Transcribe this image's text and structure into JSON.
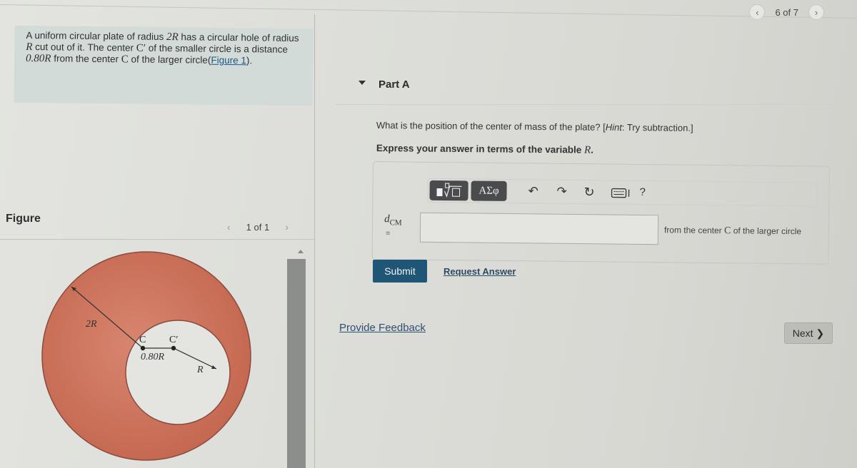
{
  "pager": {
    "current_label": "6 of 7",
    "prev_icon": "chevron-left-icon",
    "next_icon": "chevron-right-icon"
  },
  "problem": {
    "text_1": "A uniform circular plate of radius ",
    "var_2R": "2R",
    "text_2": " has a circular hole of radius ",
    "var_R": "R",
    "text_3": " cut out of it. The center ",
    "var_Cprime": "C′",
    "text_4": " of the smaller circle is a distance ",
    "var_dist": "0.80R",
    "text_5": " from the center ",
    "var_C": "C",
    "text_6": " of the larger circle(",
    "figure_link": "Figure 1",
    "text_7": ")."
  },
  "figure": {
    "title": "Figure",
    "pager_label": "1 of 1",
    "labels": {
      "outer_radius": "2R",
      "inner_radius": "R",
      "center": "C",
      "center_prime": "C′",
      "distance": "0.80R"
    },
    "colors": {
      "plate": "#c9705a",
      "plate_edge": "#8a4b3e",
      "hole": "#e4e4e0"
    }
  },
  "part": {
    "title": "Part A",
    "question_main": "What is the position of the center of mass of the plate? [",
    "question_hint_label": "Hint",
    "question_hint_text": ": Try subtraction.]",
    "instruction_text": "Express your answer in terms of the variable ",
    "instruction_var": "R",
    "instruction_end": "."
  },
  "toolbar": {
    "templates_icon": "template-sqrt-icon",
    "symbols_label": "ΑΣφ",
    "undo_icon": "undo-icon",
    "redo_icon": "redo-icon",
    "reset_icon": "reset-icon",
    "keyboard_icon": "keyboard-icon",
    "help_label": "?"
  },
  "answer": {
    "variable": "d",
    "variable_sub": "CM",
    "equals": "=",
    "value": "",
    "units_text": "from the center ",
    "units_var": "C",
    "units_end": " of the larger circle"
  },
  "actions": {
    "submit_label": "Submit",
    "request_answer_label": "Request Answer",
    "feedback_label": "Provide Feedback",
    "next_label": "Next",
    "next_icon": "❯"
  },
  "colors": {
    "submit_bg": "#1f5676",
    "link": "#2e5070",
    "problem_bg": "#d3dbd8"
  }
}
